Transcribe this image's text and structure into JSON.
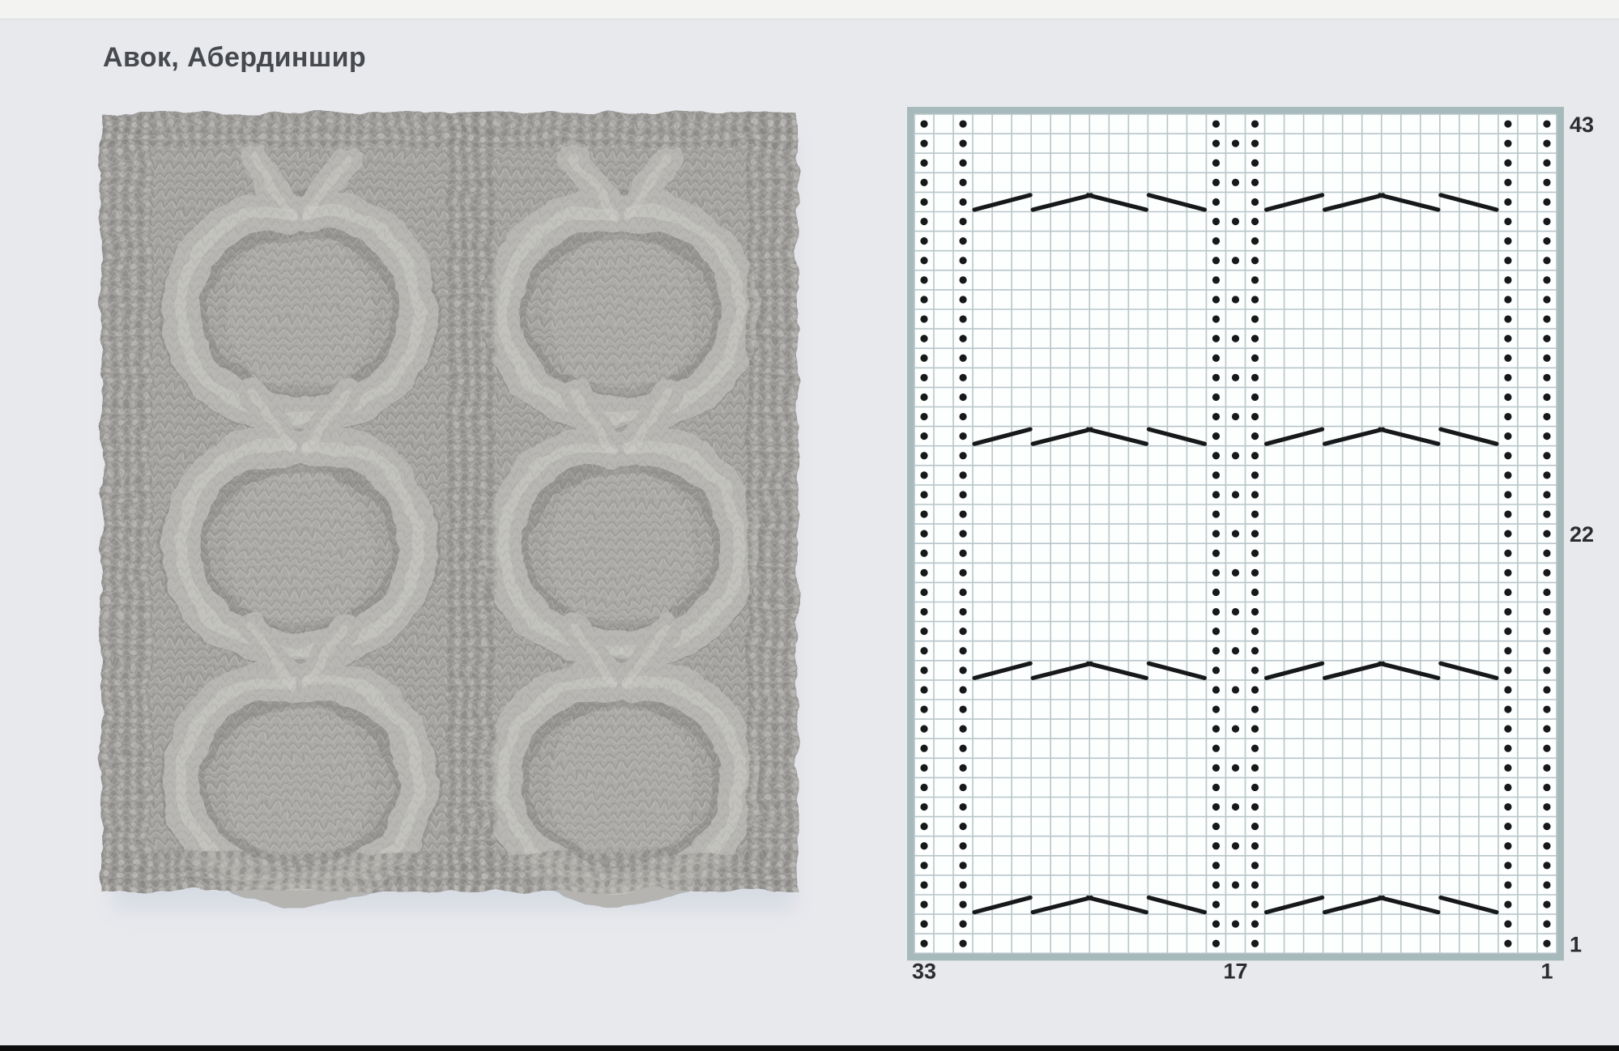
{
  "page": {
    "title": "Авок, Абердиншир",
    "background_color": "#e8e9ed",
    "top_strip_color": "#f3f3f2",
    "bottom_bar_color": "#0d0d0e",
    "title_color": "#46494d"
  },
  "swatch_photo": {
    "description": "Фото образца: серое вязаное полотно, две вертикальные панели крупной косы-подковы (кольца с V-образной развилкой), разделённые жемчужной дорожкой",
    "colors": {
      "base": "#a2a09d",
      "strand": "#b5b4b0",
      "highlight": "#d0cfca",
      "shadow": "#747370",
      "moss": "#93918e",
      "light": "#c4c3bf",
      "page_shadow": "#d6dbe3"
    }
  },
  "chart_data": {
    "type": "knitting-chart",
    "stitches": 33,
    "rows": 43,
    "symbols": {
      "dot": "purl",
      "blank": "knit",
      "diagonals": "cable-cross"
    },
    "purl_every_row_stitches": [
      33,
      31,
      18,
      16,
      3,
      1
    ],
    "alternating_purl_stitch": 17,
    "alternating_purl_row_parity": "even",
    "cable_rows": [
      3,
      15,
      27,
      39
    ],
    "cable_panels": [
      {
        "from_stitch": 30,
        "to_stitch": 19,
        "segments": [
          "rise",
          "rise",
          "fall",
          "fall"
        ],
        "cells_per_segment": 3
      },
      {
        "from_stitch": 15,
        "to_stitch": 4,
        "segments": [
          "rise",
          "rise",
          "fall",
          "fall"
        ],
        "cells_per_segment": 3
      }
    ],
    "right_row_labels": [
      {
        "row": 43,
        "label": "43"
      },
      {
        "row": 22,
        "label": "22"
      },
      {
        "row": 1,
        "label": "1"
      }
    ],
    "bottom_stitch_labels": [
      {
        "stitch": 33,
        "label": "33"
      },
      {
        "stitch": 17,
        "label": "17"
      },
      {
        "stitch": 1,
        "label": "1"
      }
    ],
    "colors": {
      "border": "#a6b9bb",
      "grid": "#b8c6c9",
      "cell": "#fdfefe",
      "symbol": "#17181a",
      "label": "#2a2c2e"
    }
  }
}
